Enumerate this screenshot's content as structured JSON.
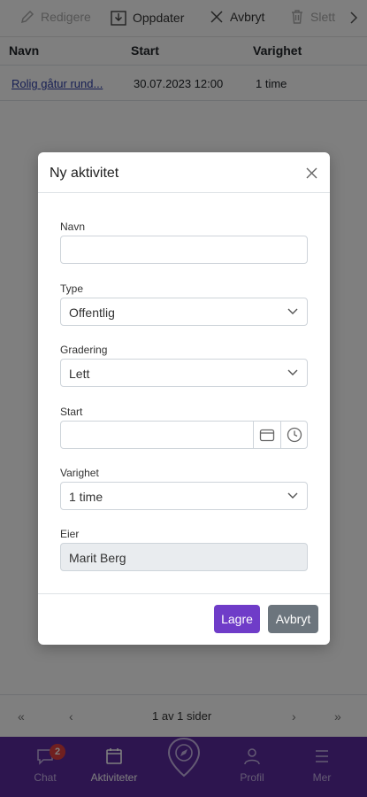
{
  "toolbar": {
    "edit_label": "Redigere",
    "refresh_label": "Oppdater",
    "cancel_label": "Avbryt",
    "delete_label": "Slett"
  },
  "table": {
    "headers": [
      "Navn",
      "Start",
      "Varighet"
    ],
    "rows": [
      {
        "name": "Rolig gåtur rund...",
        "start": "30.07.2023 12:00",
        "duration": "1 time"
      }
    ]
  },
  "pager": {
    "info": "1 av 1 sider",
    "first": "«",
    "prev": "‹",
    "next": "›",
    "last": "»"
  },
  "nav": {
    "chat_label": "Chat",
    "chat_badge": "2",
    "activities_label": "Aktiviteter",
    "profile_label": "Profil",
    "more_label": "Mer"
  },
  "modal": {
    "title": "Ny aktivitet",
    "name_label": "Navn",
    "name_value": "",
    "type_label": "Type",
    "type_value": "Offentlig",
    "grade_label": "Gradering",
    "grade_value": "Lett",
    "start_label": "Start",
    "start_value": "",
    "duration_label": "Varighet",
    "duration_value": "1 time",
    "owner_label": "Eier",
    "owner_value": "Marit Berg",
    "save_label": "Lagre",
    "cancel_label": "Avbryt"
  },
  "colors": {
    "accent": "#5b2a9e",
    "primary_button": "#6f3cc8",
    "secondary_button": "#6c757d",
    "link": "#2f3fa8",
    "badge": "#e04040"
  }
}
